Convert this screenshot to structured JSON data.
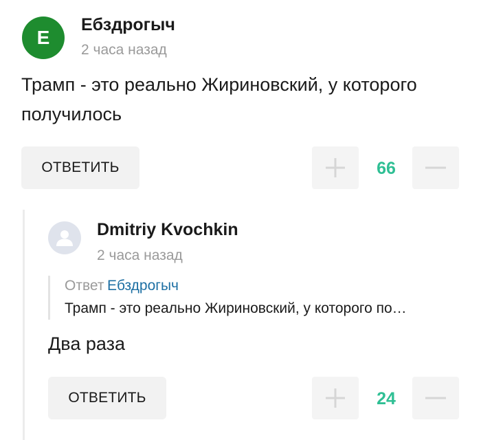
{
  "top_comment": {
    "avatar_letter": "Е",
    "author": "Ебздрогыч",
    "timestamp": "2 часа назад",
    "text": "Трамп - это реально Жириновский, у которого получилось",
    "reply_label": "ОТВЕТИТЬ",
    "score": "66"
  },
  "reply_comment": {
    "author": "Dmitriy Kvochkin",
    "timestamp": "2 часа назад",
    "quote_prefix": "Ответ",
    "quote_author": "Ебздрогыч",
    "quote_text": "Трамп - это реально Жириновский, у которого по…",
    "text": "Два раза",
    "reply_label": "ОТВЕТИТЬ",
    "score": "24"
  },
  "colors": {
    "avatar_green": "#1e8c2f",
    "score_green": "#2fbf94",
    "link_blue": "#1d6fa3"
  },
  "icons": {
    "upvote": "plus-icon",
    "downvote": "minus-icon",
    "default_avatar": "user-silhouette-icon"
  }
}
